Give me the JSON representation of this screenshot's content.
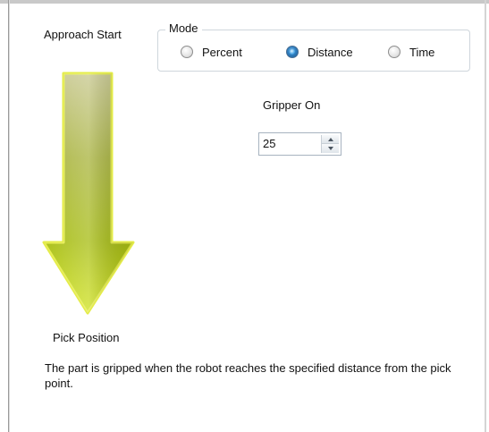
{
  "approach_start_label": "Approach Start",
  "mode": {
    "legend": "Mode",
    "options": [
      {
        "label": "Percent",
        "checked": false
      },
      {
        "label": "Distance",
        "checked": true
      },
      {
        "label": "Time",
        "checked": false
      }
    ]
  },
  "gripper": {
    "label": "Gripper On",
    "value": "25"
  },
  "pick_position_label": "Pick Position",
  "description": "The part is gripped when the robot reaches the specified distance from the pick point.",
  "icons": {
    "arrow": "down-arrow-icon",
    "spin_up": "chevron-up-icon",
    "spin_down": "chevron-down-icon"
  },
  "colors": {
    "arrow_top": "#c5c48a",
    "arrow_mid": "#a4b91a",
    "arrow_bottom": "#c9dd1b",
    "radio_selected": "#2f7fc0"
  }
}
